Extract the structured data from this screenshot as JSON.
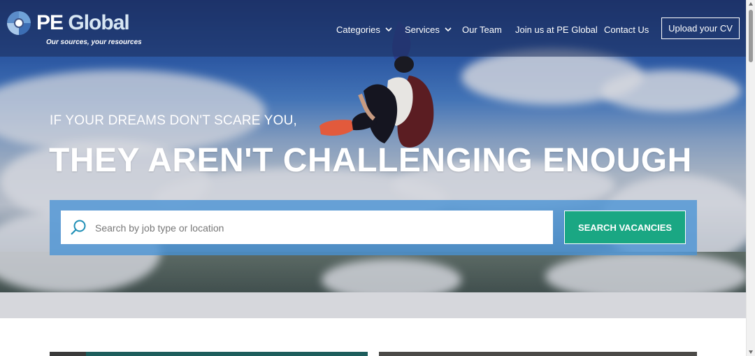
{
  "brand": {
    "name_part1": "PE",
    "name_part2": "Global",
    "tagline": "Our sources, your resources"
  },
  "nav": {
    "items": [
      {
        "label": "Categories",
        "dropdown": true
      },
      {
        "label": "Services",
        "dropdown": true
      },
      {
        "label": "Our Team",
        "dropdown": false
      },
      {
        "label": "Join us at PE Global",
        "dropdown": false
      },
      {
        "label": "Contact Us",
        "dropdown": false
      }
    ],
    "upload_cv_label": "Upload your CV"
  },
  "hero": {
    "subheading": "IF YOUR DREAMS DON'T SCARE YOU,",
    "headline": "THEY AREN'T CHALLENGING ENOUGH"
  },
  "search": {
    "placeholder": "Search by job type or location",
    "value": "",
    "button_label": "SEARCH VACANCIES"
  },
  "icons": {
    "logo": "pe-global-logo-icon",
    "chevron": "chevron-down-icon",
    "search": "search-icon"
  },
  "colors": {
    "accent_green": "#1aa783",
    "search_panel": "#4892d5",
    "header_overlay": "#1e2d5a"
  }
}
